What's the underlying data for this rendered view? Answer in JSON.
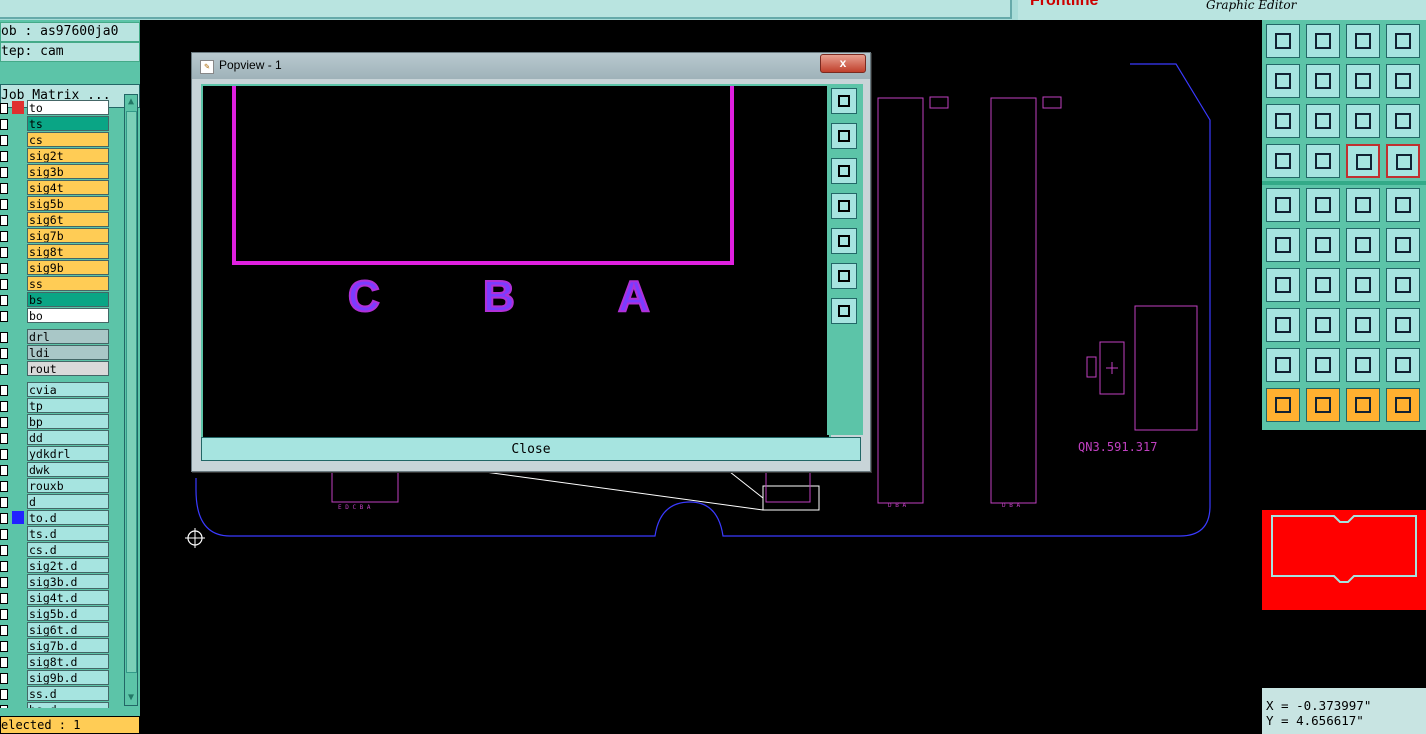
{
  "top": {
    "brand_logo": "Frontline",
    "brand_sub": "Graphic Editor"
  },
  "left": {
    "job": "ob : as97600ja0",
    "step": "tep: cam",
    "job_matrix": "Job Matrix ...",
    "selected": "elected : 1",
    "layers": [
      {
        "name": "to",
        "color": "white",
        "marker": "red-arrow"
      },
      {
        "name": "ts",
        "color": "teal"
      },
      {
        "name": "cs",
        "color": "orange"
      },
      {
        "name": "sig2t",
        "color": "orange"
      },
      {
        "name": "sig3b",
        "color": "orange"
      },
      {
        "name": "sig4t",
        "color": "orange"
      },
      {
        "name": "sig5b",
        "color": "orange"
      },
      {
        "name": "sig6t",
        "color": "orange"
      },
      {
        "name": "sig7b",
        "color": "orange"
      },
      {
        "name": "sig8t",
        "color": "orange"
      },
      {
        "name": "sig9b",
        "color": "orange"
      },
      {
        "name": "ss",
        "color": "orange"
      },
      {
        "name": "bs",
        "color": "teal"
      },
      {
        "name": "bo",
        "color": "white"
      },
      {
        "name": "drl",
        "color": "grey"
      },
      {
        "name": "ldi",
        "color": "grey"
      },
      {
        "name": "rout",
        "color": "lgrey"
      },
      {
        "name": "cvia",
        "color": "cyan"
      },
      {
        "name": "tp",
        "color": "cyan"
      },
      {
        "name": "bp",
        "color": "cyan"
      },
      {
        "name": "dd",
        "color": "cyan"
      },
      {
        "name": "ydkdrl",
        "color": "cyan"
      },
      {
        "name": "dwk",
        "color": "cyan"
      },
      {
        "name": "rouxb",
        "color": "cyan"
      },
      {
        "name": "d",
        "color": "cyan"
      },
      {
        "name": "to.d",
        "color": "cyan",
        "marker": "blue-square"
      },
      {
        "name": "ts.d",
        "color": "cyan"
      },
      {
        "name": "cs.d",
        "color": "cyan"
      },
      {
        "name": "sig2t.d",
        "color": "cyan"
      },
      {
        "name": "sig3b.d",
        "color": "cyan"
      },
      {
        "name": "sig4t.d",
        "color": "cyan"
      },
      {
        "name": "sig5b.d",
        "color": "cyan"
      },
      {
        "name": "sig6t.d",
        "color": "cyan"
      },
      {
        "name": "sig7b.d",
        "color": "cyan"
      },
      {
        "name": "sig8t.d",
        "color": "cyan"
      },
      {
        "name": "sig9b.d",
        "color": "cyan"
      },
      {
        "name": "ss.d",
        "color": "cyan"
      },
      {
        "name": "bs.d",
        "color": "cyan"
      }
    ]
  },
  "canvas": {
    "part_label": "QN3.591.317",
    "small_label": "E D C B A"
  },
  "popup": {
    "title": "Popview - 1",
    "close_x": "x",
    "close_button": "Close",
    "letters": [
      "C",
      "B",
      "A"
    ]
  },
  "right": {
    "coord_x": "X = -0.373997\"",
    "coord_y": "Y = 4.656617\""
  },
  "colors": {
    "panel": "#5cc4a8",
    "button": "#a6e4e0",
    "magenta": "#c040c0",
    "outline_blue": "#3a3aff"
  }
}
